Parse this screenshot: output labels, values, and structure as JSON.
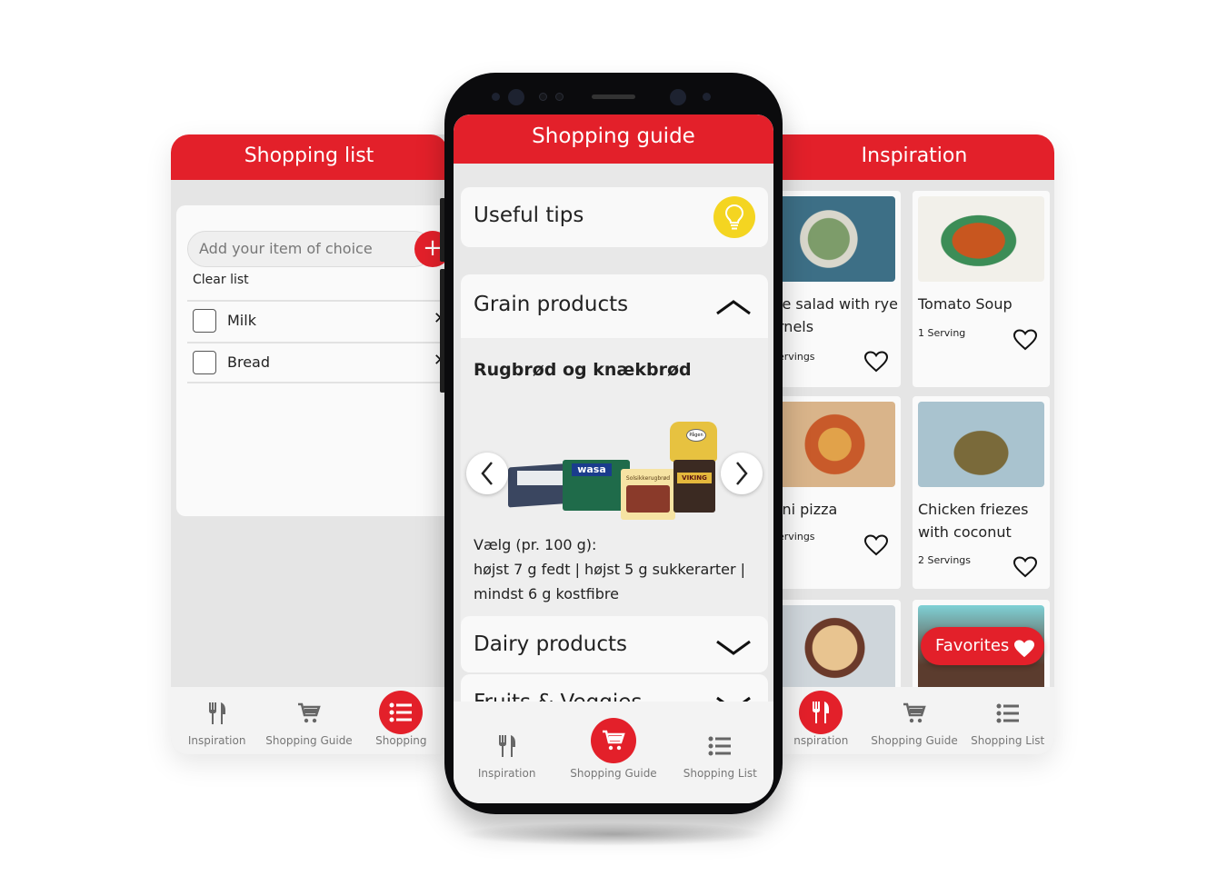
{
  "colors": {
    "brand_red": "#e3202a",
    "bulb_yellow": "#f4d521",
    "background": "#e8e8e8"
  },
  "left_screen": {
    "title": "Shopping list",
    "input_placeholder": "Add your item of choice",
    "add_icon": "plus-icon",
    "clear_label": "Clear list",
    "items": [
      {
        "label": "Milk",
        "checked": false
      },
      {
        "label": "Bread",
        "checked": false
      }
    ],
    "tabs": [
      {
        "label": "Inspiration",
        "icon": "cutlery-icon",
        "active": false
      },
      {
        "label": "Shopping Guide",
        "icon": "cart-icon",
        "active": false
      },
      {
        "label": "Shopping",
        "icon": "list-icon",
        "active": true
      }
    ]
  },
  "center_screen": {
    "title": "Shopping guide",
    "tips_label": "Useful tips",
    "tips_icon": "lightbulb-icon",
    "sections": [
      {
        "label": "Grain products",
        "expanded": true
      },
      {
        "label": "Dairy products",
        "expanded": false
      },
      {
        "label": "Fruits & Veggies",
        "expanded": false
      }
    ],
    "subsection_title": "Rugbrød og knækbrød",
    "description_lines": [
      "Vælg (pr. 100 g):",
      "højst 7 g fedt | højst 5 g sukkerarter |",
      "mindst 6 g kostfibre"
    ],
    "product_labels": [
      "wasa",
      "Solsikkerugbrød",
      "VIKING",
      "Pågen"
    ],
    "tabs": [
      {
        "label": "Inspiration",
        "icon": "cutlery-icon",
        "active": false
      },
      {
        "label": "Shopping Guide",
        "icon": "cart-icon",
        "active": true
      },
      {
        "label": "Shopping List",
        "icon": "list-icon",
        "active": false
      }
    ]
  },
  "right_screen": {
    "title": "Inspiration",
    "recipes": [
      {
        "name_lines": [
          "le salad with rye",
          "rnels"
        ],
        "servings": "ervings"
      },
      {
        "name_lines": [
          "Tomato Soup"
        ],
        "servings": "1 Serving"
      },
      {
        "name_lines": [
          "ini pizza"
        ],
        "servings": "ervings"
      },
      {
        "name_lines": [
          "Chicken friezes",
          "with coconut"
        ],
        "servings": "2 Servings"
      }
    ],
    "favorites_label": "Favorites",
    "tabs": [
      {
        "label": "nspiration",
        "icon": "cutlery-icon",
        "active": true
      },
      {
        "label": "Shopping Guide",
        "icon": "cart-icon",
        "active": false
      },
      {
        "label": "Shopping List",
        "icon": "list-icon",
        "active": false
      }
    ]
  }
}
